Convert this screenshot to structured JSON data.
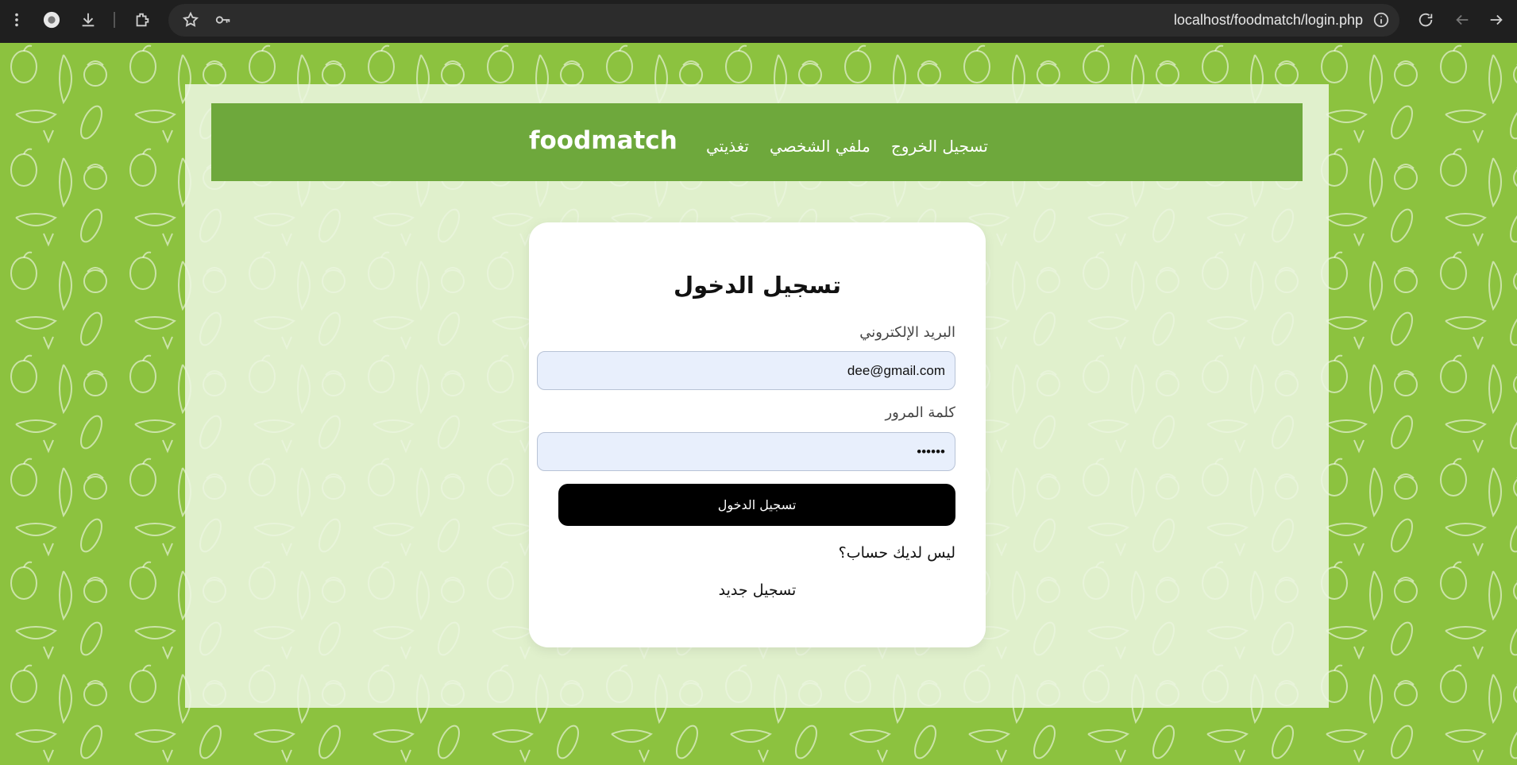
{
  "browser": {
    "url": "localhost/foodmatch/login.php",
    "icons": [
      "menu-dots-icon",
      "profile-icon",
      "download-icon",
      "extensions-icon",
      "star-icon",
      "key-icon",
      "info-icon",
      "reload-icon",
      "back-icon",
      "forward-icon"
    ]
  },
  "nav": {
    "brand": "foodmatch",
    "links": [
      "تسجيل الخروج",
      "ملفي الشخصي",
      "تغذيتي"
    ]
  },
  "login": {
    "title": "تسجيل الدخول",
    "email_label": "البريد الإلكتروني",
    "email_value": "dee@gmail.com",
    "password_label": "كلمة المرور",
    "password_value": "••••••",
    "submit_label": "تسجيل الدخول",
    "no_account_text": "ليس لديك حساب؟",
    "register_link": "تسجيل جديد"
  },
  "colors": {
    "background": "#8cc23f",
    "navbar": "#6ea83c",
    "button": "#000000",
    "input_bg": "#e8effc"
  }
}
